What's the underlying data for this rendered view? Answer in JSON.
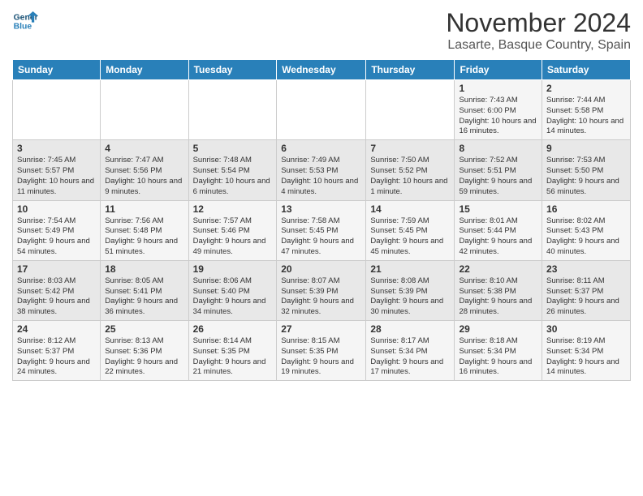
{
  "logo": {
    "line1": "General",
    "line2": "Blue"
  },
  "header": {
    "title": "November 2024",
    "subtitle": "Lasarte, Basque Country, Spain"
  },
  "weekdays": [
    "Sunday",
    "Monday",
    "Tuesday",
    "Wednesday",
    "Thursday",
    "Friday",
    "Saturday"
  ],
  "weeks": [
    [
      {
        "day": "",
        "info": ""
      },
      {
        "day": "",
        "info": ""
      },
      {
        "day": "",
        "info": ""
      },
      {
        "day": "",
        "info": ""
      },
      {
        "day": "",
        "info": ""
      },
      {
        "day": "1",
        "info": "Sunrise: 7:43 AM\nSunset: 6:00 PM\nDaylight: 10 hours and 16 minutes."
      },
      {
        "day": "2",
        "info": "Sunrise: 7:44 AM\nSunset: 5:58 PM\nDaylight: 10 hours and 14 minutes."
      }
    ],
    [
      {
        "day": "3",
        "info": "Sunrise: 7:45 AM\nSunset: 5:57 PM\nDaylight: 10 hours and 11 minutes."
      },
      {
        "day": "4",
        "info": "Sunrise: 7:47 AM\nSunset: 5:56 PM\nDaylight: 10 hours and 9 minutes."
      },
      {
        "day": "5",
        "info": "Sunrise: 7:48 AM\nSunset: 5:54 PM\nDaylight: 10 hours and 6 minutes."
      },
      {
        "day": "6",
        "info": "Sunrise: 7:49 AM\nSunset: 5:53 PM\nDaylight: 10 hours and 4 minutes."
      },
      {
        "day": "7",
        "info": "Sunrise: 7:50 AM\nSunset: 5:52 PM\nDaylight: 10 hours and 1 minute."
      },
      {
        "day": "8",
        "info": "Sunrise: 7:52 AM\nSunset: 5:51 PM\nDaylight: 9 hours and 59 minutes."
      },
      {
        "day": "9",
        "info": "Sunrise: 7:53 AM\nSunset: 5:50 PM\nDaylight: 9 hours and 56 minutes."
      }
    ],
    [
      {
        "day": "10",
        "info": "Sunrise: 7:54 AM\nSunset: 5:49 PM\nDaylight: 9 hours and 54 minutes."
      },
      {
        "day": "11",
        "info": "Sunrise: 7:56 AM\nSunset: 5:48 PM\nDaylight: 9 hours and 51 minutes."
      },
      {
        "day": "12",
        "info": "Sunrise: 7:57 AM\nSunset: 5:46 PM\nDaylight: 9 hours and 49 minutes."
      },
      {
        "day": "13",
        "info": "Sunrise: 7:58 AM\nSunset: 5:45 PM\nDaylight: 9 hours and 47 minutes."
      },
      {
        "day": "14",
        "info": "Sunrise: 7:59 AM\nSunset: 5:45 PM\nDaylight: 9 hours and 45 minutes."
      },
      {
        "day": "15",
        "info": "Sunrise: 8:01 AM\nSunset: 5:44 PM\nDaylight: 9 hours and 42 minutes."
      },
      {
        "day": "16",
        "info": "Sunrise: 8:02 AM\nSunset: 5:43 PM\nDaylight: 9 hours and 40 minutes."
      }
    ],
    [
      {
        "day": "17",
        "info": "Sunrise: 8:03 AM\nSunset: 5:42 PM\nDaylight: 9 hours and 38 minutes."
      },
      {
        "day": "18",
        "info": "Sunrise: 8:05 AM\nSunset: 5:41 PM\nDaylight: 9 hours and 36 minutes."
      },
      {
        "day": "19",
        "info": "Sunrise: 8:06 AM\nSunset: 5:40 PM\nDaylight: 9 hours and 34 minutes."
      },
      {
        "day": "20",
        "info": "Sunrise: 8:07 AM\nSunset: 5:39 PM\nDaylight: 9 hours and 32 minutes."
      },
      {
        "day": "21",
        "info": "Sunrise: 8:08 AM\nSunset: 5:39 PM\nDaylight: 9 hours and 30 minutes."
      },
      {
        "day": "22",
        "info": "Sunrise: 8:10 AM\nSunset: 5:38 PM\nDaylight: 9 hours and 28 minutes."
      },
      {
        "day": "23",
        "info": "Sunrise: 8:11 AM\nSunset: 5:37 PM\nDaylight: 9 hours and 26 minutes."
      }
    ],
    [
      {
        "day": "24",
        "info": "Sunrise: 8:12 AM\nSunset: 5:37 PM\nDaylight: 9 hours and 24 minutes."
      },
      {
        "day": "25",
        "info": "Sunrise: 8:13 AM\nSunset: 5:36 PM\nDaylight: 9 hours and 22 minutes."
      },
      {
        "day": "26",
        "info": "Sunrise: 8:14 AM\nSunset: 5:35 PM\nDaylight: 9 hours and 21 minutes."
      },
      {
        "day": "27",
        "info": "Sunrise: 8:15 AM\nSunset: 5:35 PM\nDaylight: 9 hours and 19 minutes."
      },
      {
        "day": "28",
        "info": "Sunrise: 8:17 AM\nSunset: 5:34 PM\nDaylight: 9 hours and 17 minutes."
      },
      {
        "day": "29",
        "info": "Sunrise: 8:18 AM\nSunset: 5:34 PM\nDaylight: 9 hours and 16 minutes."
      },
      {
        "day": "30",
        "info": "Sunrise: 8:19 AM\nSunset: 5:34 PM\nDaylight: 9 hours and 14 minutes."
      }
    ]
  ]
}
